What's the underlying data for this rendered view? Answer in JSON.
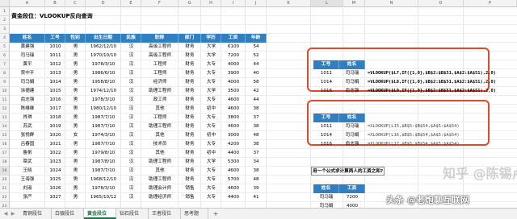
{
  "title": "黄金段位：VLOOKUP反向查询",
  "columns": [
    "A",
    "B",
    "C",
    "D",
    "E",
    "F",
    "G",
    "H",
    "I",
    "J",
    "K",
    "L",
    "M",
    "N",
    "O",
    "P"
  ],
  "selected_column": "L",
  "rows": [
    "1",
    "2",
    "3",
    "4",
    "5",
    "6",
    "7",
    "8",
    "9",
    "10",
    "11",
    "12",
    "13",
    "14",
    "15",
    "16",
    "17",
    "18",
    "19",
    "20",
    "21",
    "22",
    "23"
  ],
  "selected_row": "19",
  "main_table": {
    "headers": [
      "姓名",
      "工号",
      "性别",
      "出生日期",
      "民族",
      "职称",
      "部门",
      "学历",
      "工资",
      "年龄"
    ],
    "rows": [
      [
        "黄建强",
        "1010",
        "男",
        "1962/12/10",
        "汉",
        "高级工程师",
        "财务",
        "大学",
        "6100",
        "54"
      ],
      [
        "司马瑞",
        "1011",
        "男",
        "1970/10/10",
        "汉",
        "高级工程师",
        "财务",
        "大学",
        "7200",
        "52"
      ],
      [
        "黄平",
        "1012",
        "男",
        "1978/3/10",
        "汉",
        "工程师",
        "财务",
        "大专",
        "4000",
        "44"
      ],
      [
        "贾中平",
        "1013",
        "男",
        "1986/6/10",
        "汉",
        "工程师",
        "财务",
        "大专",
        "3900",
        "40"
      ],
      [
        "司马娟",
        "1014",
        "男",
        "1958/8/10",
        "汉",
        "经济师",
        "财务",
        "大专",
        "4000",
        "58"
      ],
      [
        "涂德建",
        "1015",
        "男",
        "1974/12/10",
        "汉",
        "助理工程师",
        "财务",
        "大学",
        "3500",
        "42"
      ],
      [
        "俞志强",
        "1016",
        "男",
        "1978/3/10",
        "汉",
        "政工师",
        "财务",
        "大专",
        "4600",
        "44"
      ],
      [
        "陈维维",
        "1017",
        "男",
        "1980/12/10",
        "汉",
        "其他",
        "财务",
        "初中",
        "4600",
        "38"
      ],
      [
        "肖琪",
        "1018",
        "男",
        "1987/7/10",
        "汉",
        "工程师",
        "财务",
        "大专",
        "3800",
        "37"
      ],
      [
        "苏武",
        "1019",
        "男",
        "1987/7/10",
        "汉",
        "助理工程师",
        "财务",
        "大专",
        "4600",
        "38"
      ],
      [
        "张悦群",
        "1020",
        "女",
        "1974/3/10",
        "汉",
        "其他",
        "财务",
        "初中",
        "3000",
        "48"
      ],
      [
        "吕春国",
        "1021",
        "男",
        "1987/7/10",
        "汉",
        "技术员",
        "财务",
        "大专",
        "4200",
        "38"
      ],
      [
        "鲁帆",
        "1022",
        "男",
        "1979/8/10",
        "汉",
        "其他",
        "财务",
        "初中",
        "4400",
        "37"
      ],
      [
        "章武",
        "1023",
        "男",
        "1987/8/10",
        "汉",
        "助理工程师",
        "财务",
        "大学",
        "5300",
        "34"
      ],
      [
        "王晓",
        "1024",
        "男",
        "1987/7/10",
        "汉",
        "其他",
        "财务",
        "大专",
        "4600",
        "38"
      ],
      [
        "王海强",
        "1025",
        "男",
        "1968/12/10",
        "汉",
        "助理工程师",
        "财务",
        "大专",
        "5700",
        "48"
      ],
      [
        "刘淑",
        "1026",
        "男",
        "1978/3/10",
        "汉",
        "助理会计师",
        "销售",
        "大专",
        "4600",
        "39"
      ],
      [
        "张严",
        "1027",
        "男",
        "1965/10/12",
        "汉",
        "助理经济师",
        "销售",
        "大专",
        "4400",
        "41"
      ]
    ]
  },
  "lookup_table_1": {
    "headers": [
      "工号",
      "姓名"
    ],
    "rows": [
      {
        "id": "1011",
        "name": "司马瑞",
        "formula": "=VLOOKUP($L7,IF({1,0},$B$2:$B$51,$A$2:$A$51),2,0)"
      },
      {
        "id": "1014",
        "name": "司马娟",
        "formula": "=VLOOKUP($L8,IF({1,0},$B$2:$B$51,$A$2:$A$51),2,0)"
      },
      {
        "id": "1016",
        "name": "俞志强",
        "formula": "=VLOOKUP($L9,IF({1,0},$B$2:$B$51,$A$2:$A$51),2,0)"
      }
    ]
  },
  "lookup_table_2": {
    "headers": [
      "工号",
      "姓名"
    ],
    "rows": [
      {
        "id": "1011",
        "name": "司马瑞",
        "formula": "=XLOOKUP(L15,$B$5:$B$54,$A$5:$A$54)"
      },
      {
        "id": "1014",
        "name": "司马娟",
        "formula": "=XLOOKUP(L16,$B$5:$B$54,$A$5:$A$54)"
      },
      {
        "id": "1016",
        "name": "俞志强",
        "formula": "=XLOOKUP(L17,$B$5:$B$54,$A$5:$A$54)"
      }
    ]
  },
  "question": "用一个公式求计算两人的工资之和?",
  "sum_table": {
    "headers": [
      "姓名",
      "工资"
    ],
    "rows": [
      [
        "司马瑞",
        "7200"
      ],
      [
        "司马娟",
        "4000"
      ]
    ]
  },
  "sheet_tabs": [
    "青铜段位",
    "白银段位",
    "黄金段位",
    "钻石段位",
    "王者段位",
    "思考题"
  ],
  "active_tab": "黄金段位",
  "add_sheet": "+",
  "watermark": "头条 @老炮聊互联网",
  "watermark_faint": "知乎 @陈锡卢",
  "colors": {
    "header_blue": "#2f7fc1",
    "box_red": "#e04a2b",
    "excel_green": "#217346"
  }
}
